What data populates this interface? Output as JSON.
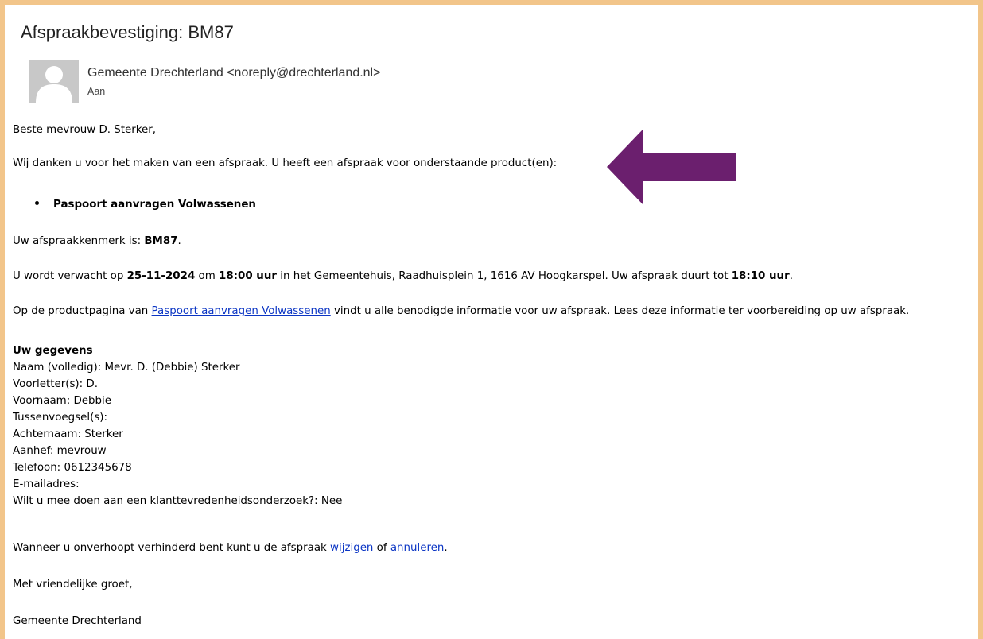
{
  "subject": "Afspraakbevestiging: BM87",
  "sender": {
    "display": "Gemeente Drechterland <noreply@drechterland.nl>",
    "to_label": "Aan"
  },
  "body": {
    "greeting": "Beste mevrouw D. Sterker,",
    "thanks": "Wij danken u voor het maken van een afspraak. U heeft een afspraak voor onderstaande product(en):",
    "product_item": "Paspoort aanvragen Volwassenen",
    "ref_prefix": "Uw afspraakkenmerk is: ",
    "ref_code": "BM87",
    "ref_suffix": ".",
    "appt_1": "U wordt verwacht op ",
    "appt_date": "25-11-2024",
    "appt_2": " om ",
    "appt_time": "18:00 uur",
    "appt_3": " in het Gemeentehuis, Raadhuisplein 1, 1616 AV Hoogkarspel. Uw afspraak duurt tot ",
    "appt_end": "18:10 uur",
    "appt_4": ".",
    "product_1": "Op de productpagina van ",
    "product_link": "Paspoort aanvragen Volwassenen",
    "product_2": " vindt u alle benodigde informatie voor uw afspraak. Lees deze informatie ter voorbereiding op uw afspraak.",
    "details_heading": "Uw gegevens",
    "details": [
      "Naam (volledig): Mevr. D. (Debbie) Sterker",
      "Voorletter(s): D.",
      "Voornaam: Debbie",
      "Tussenvoegsel(s):",
      "Achternaam: Sterker",
      "Aanhef: mevrouw",
      "Telefoon: 0612345678",
      "E-mailadres:",
      "Wilt u mee doen aan een klanttevredenheidsonderzoek?: Nee"
    ],
    "change_1": "Wanneer u onverhoopt verhinderd bent kunt u de afspraak ",
    "change_link_1": "wijzigen",
    "change_2": " of ",
    "change_link_2": "annuleren",
    "change_3": ".",
    "regards": "Met vriendelijke groet,",
    "signature": "Gemeente Drechterland"
  },
  "colors": {
    "frame": "#f2c58a",
    "arrow": "#6b1f6e",
    "link": "#0b35c4"
  },
  "icons": {
    "avatar": "person-placeholder-icon",
    "annotation": "left-arrow-icon"
  }
}
